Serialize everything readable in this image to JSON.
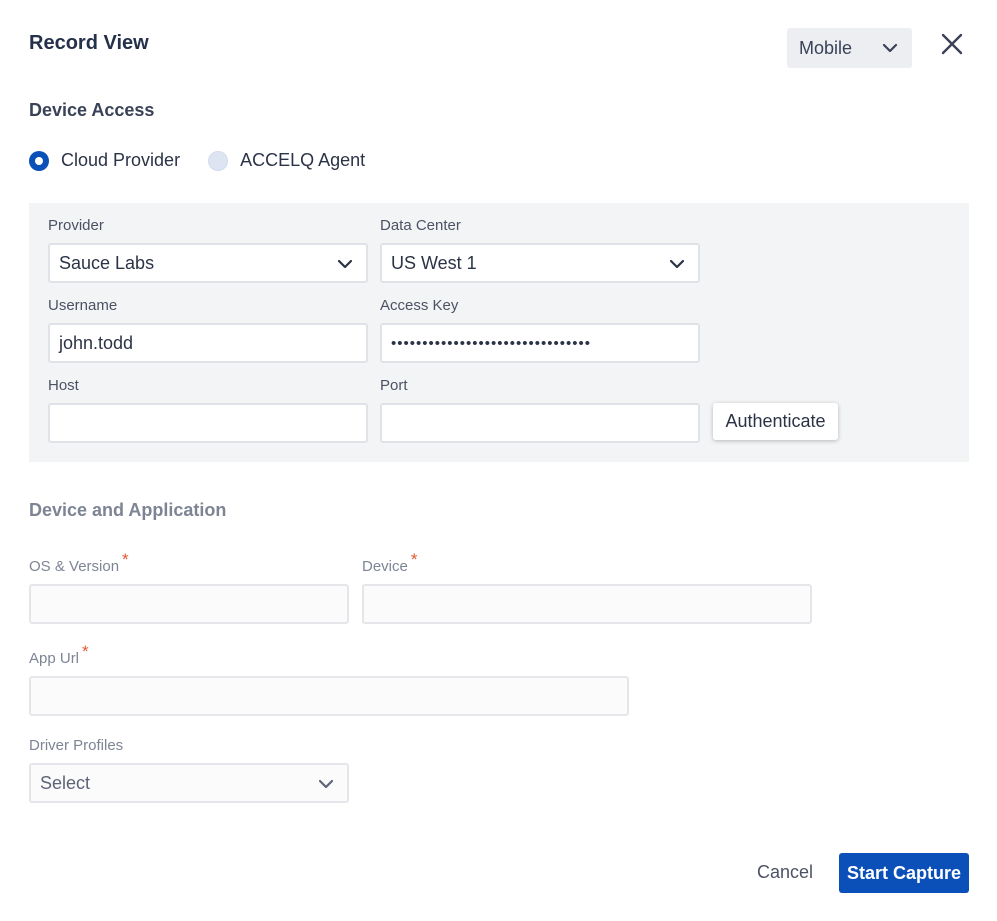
{
  "header": {
    "title": "Record View",
    "mode": "Mobile",
    "close_icon": "close-icon"
  },
  "device_access": {
    "title": "Device Access",
    "options": [
      {
        "label": "Cloud Provider",
        "selected": true
      },
      {
        "label": "ACCELQ Agent",
        "selected": false
      }
    ],
    "provider": {
      "label": "Provider",
      "value": "Sauce Labs"
    },
    "data_center": {
      "label": "Data Center",
      "value": "US West 1"
    },
    "username": {
      "label": "Username",
      "value": "john.todd"
    },
    "access_key": {
      "label": "Access Key",
      "value": "••••••••••••••••••••••••••••••••"
    },
    "host": {
      "label": "Host",
      "value": ""
    },
    "port": {
      "label": "Port",
      "value": ""
    },
    "authenticate_label": "Authenticate"
  },
  "device_application": {
    "title": "Device and Application",
    "os_version": {
      "label": "OS & Version",
      "required": "*",
      "value": ""
    },
    "device": {
      "label": "Device",
      "required": "*",
      "value": ""
    },
    "app_url": {
      "label": "App Url",
      "required": "*",
      "value": ""
    },
    "driver_profiles": {
      "label": "Driver Profiles",
      "value": "Select"
    }
  },
  "footer": {
    "cancel_label": "Cancel",
    "start_label": "Start Capture"
  },
  "colors": {
    "primary": "#0b4fb8",
    "required": "#e4572e",
    "panel": "#f3f4f6"
  }
}
